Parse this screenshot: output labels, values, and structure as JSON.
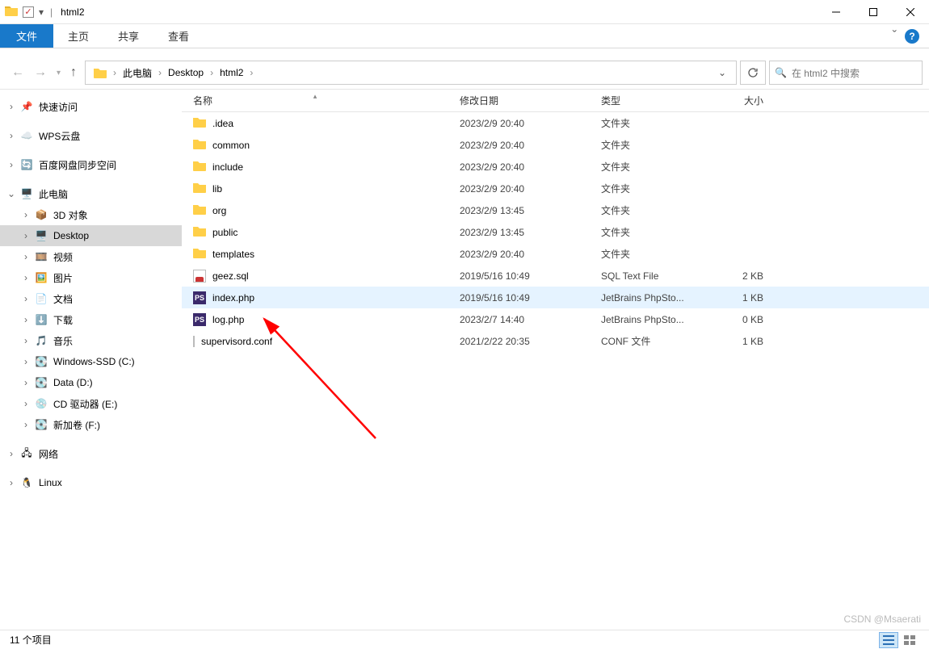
{
  "window": {
    "title": "html2",
    "minimize": "—",
    "maximize": "☐",
    "close": "✕"
  },
  "ribbon": {
    "file": "文件",
    "tabs": [
      "主页",
      "共享",
      "查看"
    ],
    "caret": "ˇ"
  },
  "nav": {
    "back": "←",
    "forward": "→",
    "up": "↑"
  },
  "breadcrumbs": [
    "此电脑",
    "Desktop",
    "html2"
  ],
  "search": {
    "placeholder": "在 html2 中搜索",
    "icon_label": "🔍"
  },
  "columns": {
    "name": "名称",
    "date": "修改日期",
    "type": "类型",
    "size": "大小"
  },
  "sidebar": {
    "quick": "快速访问",
    "wps": "WPS云盘",
    "baidu": "百度网盘同步空间",
    "thispc": "此电脑",
    "thispc_children": [
      "3D 对象",
      "Desktop",
      "视频",
      "图片",
      "文档",
      "下载",
      "音乐",
      "Windows-SSD (C:)",
      "Data (D:)",
      "CD 驱动器 (E:)",
      "新加卷 (F:)"
    ],
    "network": "网络",
    "linux": "Linux"
  },
  "files": [
    {
      "name": ".idea",
      "date": "2023/2/9 20:40",
      "type": "文件夹",
      "size": "",
      "icon": "folder"
    },
    {
      "name": "common",
      "date": "2023/2/9 20:40",
      "type": "文件夹",
      "size": "",
      "icon": "folder"
    },
    {
      "name": "include",
      "date": "2023/2/9 20:40",
      "type": "文件夹",
      "size": "",
      "icon": "folder"
    },
    {
      "name": "lib",
      "date": "2023/2/9 20:40",
      "type": "文件夹",
      "size": "",
      "icon": "folder"
    },
    {
      "name": "org",
      "date": "2023/2/9 13:45",
      "type": "文件夹",
      "size": "",
      "icon": "folder"
    },
    {
      "name": "public",
      "date": "2023/2/9 13:45",
      "type": "文件夹",
      "size": "",
      "icon": "folder"
    },
    {
      "name": "templates",
      "date": "2023/2/9 20:40",
      "type": "文件夹",
      "size": "",
      "icon": "folder"
    },
    {
      "name": "geez.sql",
      "date": "2019/5/16 10:49",
      "type": "SQL Text File",
      "size": "2 KB",
      "icon": "sql"
    },
    {
      "name": "index.php",
      "date": "2019/5/16 10:49",
      "type": "JetBrains PhpSto...",
      "size": "1 KB",
      "icon": "php",
      "highlight": true
    },
    {
      "name": "log.php",
      "date": "2023/2/7 14:40",
      "type": "JetBrains PhpSto...",
      "size": "0 KB",
      "icon": "php"
    },
    {
      "name": "supervisord.conf",
      "date": "2021/2/22 20:35",
      "type": "CONF 文件",
      "size": "1 KB",
      "icon": "txt"
    }
  ],
  "status": {
    "count": "11 个项目"
  },
  "watermark": "CSDN @Msaerati"
}
